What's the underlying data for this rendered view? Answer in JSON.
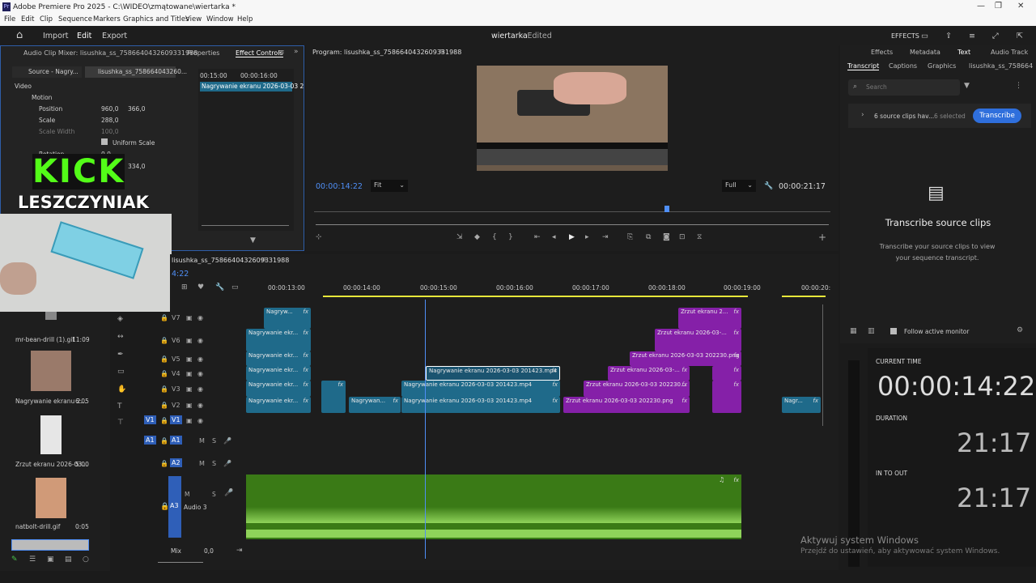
{
  "window": {
    "title": "Adobe Premiere Pro 2025 - C:\\WIDEO\\zmątowane\\wiertarka *",
    "app_badge": "Pr"
  },
  "menu": [
    "File",
    "Edit",
    "Clip",
    "Sequence",
    "Markers",
    "Graphics and Titles",
    "View",
    "Window",
    "Help"
  ],
  "workspace": {
    "import": "Import",
    "edit": "Edit",
    "export": "Export",
    "project_title": "wiertarka",
    "project_status": "- Edited",
    "effects_label": "EFFECTS"
  },
  "effect_panel": {
    "tabs": [
      "Audio Clip Mixer: lisushka_ss_7586640432609331988",
      "Properties",
      "Effect Controls"
    ],
    "source_tab": "Source - Nagry...",
    "seq_tab": "lisushka_ss_758664043260...",
    "section_video": "Video",
    "motion": "Motion",
    "position": "Position",
    "pos_x": "960,0",
    "pos_y": "366,0",
    "scale": "Scale",
    "scale_v": "288,0",
    "scale_width": "Scale Width",
    "scale_width_v": "100,0",
    "uniform_scale": "Uniform Scale",
    "rotation": "Rotation",
    "rotation_v": "0,0",
    "anchor_v": "334,0",
    "time1": "00:15:00",
    "time2": "00:00:16:00",
    "clip_label": "Nagrywanie ekranu 2026-03-03 2"
  },
  "overlay": {
    "kick": "KICK",
    "name": "LESZCZYNIAK"
  },
  "program": {
    "title": "Program: lisushka_ss_7586640432609331988",
    "timecode": "00:00:14:22",
    "fit": "Fit",
    "quality": "Full",
    "duration": "00:00:21:17"
  },
  "right_tabs": [
    "Effects",
    "Metadata",
    "Text",
    "Audio Track"
  ],
  "text_panel": {
    "subtabs": [
      "Transcript",
      "Captions",
      "Graphics",
      "lisushka_ss_758664"
    ],
    "search_placeholder": "Search",
    "source_clips": "6 source clips hav...",
    "selected": "6 selected",
    "transcribe_btn": "Transcribe",
    "heading": "Transcribe source clips",
    "desc": "Transcribe your source clips to view your sequence transcript.",
    "follow": "Follow active monitor"
  },
  "timecode_panel": {
    "current_label": "CURRENT TIME",
    "current": "00:00:14:22",
    "duration_label": "DURATION",
    "duration": "21:17",
    "inout_label": "IN TO OUT",
    "inout": "21:17"
  },
  "project": {
    "seq_name": "lisushka_ss_7586640432609331988",
    "tc_frag": "4:22",
    "items": [
      {
        "name": "mr-bean-drill (1).gif",
        "dur": "11:09"
      },
      {
        "name": "Nagrywanie ekranu 2...",
        "dur": "6:05"
      },
      {
        "name": "Zrzut ekranu 2026-03...",
        "dur": "5:00"
      },
      {
        "name": "natbolt-drill.gif",
        "dur": "0:05"
      }
    ]
  },
  "timeline": {
    "ruler": [
      "00:00:13:00",
      "00:00:14:00",
      "00:00:15:00",
      "00:00:16:00",
      "00:00:17:00",
      "00:00:18:00",
      "00:00:19:00",
      "00:00:20:"
    ],
    "tracks": [
      "V7",
      "V6",
      "V5",
      "V4",
      "V3",
      "V2",
      "V1",
      "A1",
      "A2",
      "A3"
    ],
    "audio3_name": "Audio 3",
    "mix_label": "Mix",
    "mix_value": "0,0",
    "clips": {
      "c1": "Nagryw...",
      "c2": "Nagrywanie ekr...",
      "c3": "Nagrywanie ekr...",
      "c4": "Nagrywanie ekr...",
      "c5": "Nagrywanie ekr...",
      "c6": "Nagrywanie ekr...",
      "c7": "Nagrywanie ekranu 2026-03-03 201423.mp4",
      "c8": "Nagrywanie ekranu 2026-03-03 201423.mp4",
      "c9": "Nagrywan...",
      "c10": "Nagrywanie ekranu 2026-03-03 201423.mp4",
      "p1": "Zrzut ekranu 2...",
      "p2": "Zrzut ekranu 2026-03-...",
      "p3": "Zrzut ekranu 2026-03-03 202230.png",
      "p4": "Zrzut ekranu 2026-03-...",
      "p5": "Zrzut ekranu 2026-03-03 202230...",
      "p6": "Zrzut ekranu 2026-03-03 202230.png",
      "c11": "Nagr..."
    },
    "fx": "fx"
  },
  "watermark": {
    "line1": "Aktywuj system Windows",
    "line2": "Przejdź do ustawień, aby aktywować system Windows."
  },
  "colors": {
    "accent": "#4f8ff7",
    "clip_blue": "#1f6a8a",
    "clip_purple": "#8520a8",
    "audio_green": "#3a7a16"
  }
}
